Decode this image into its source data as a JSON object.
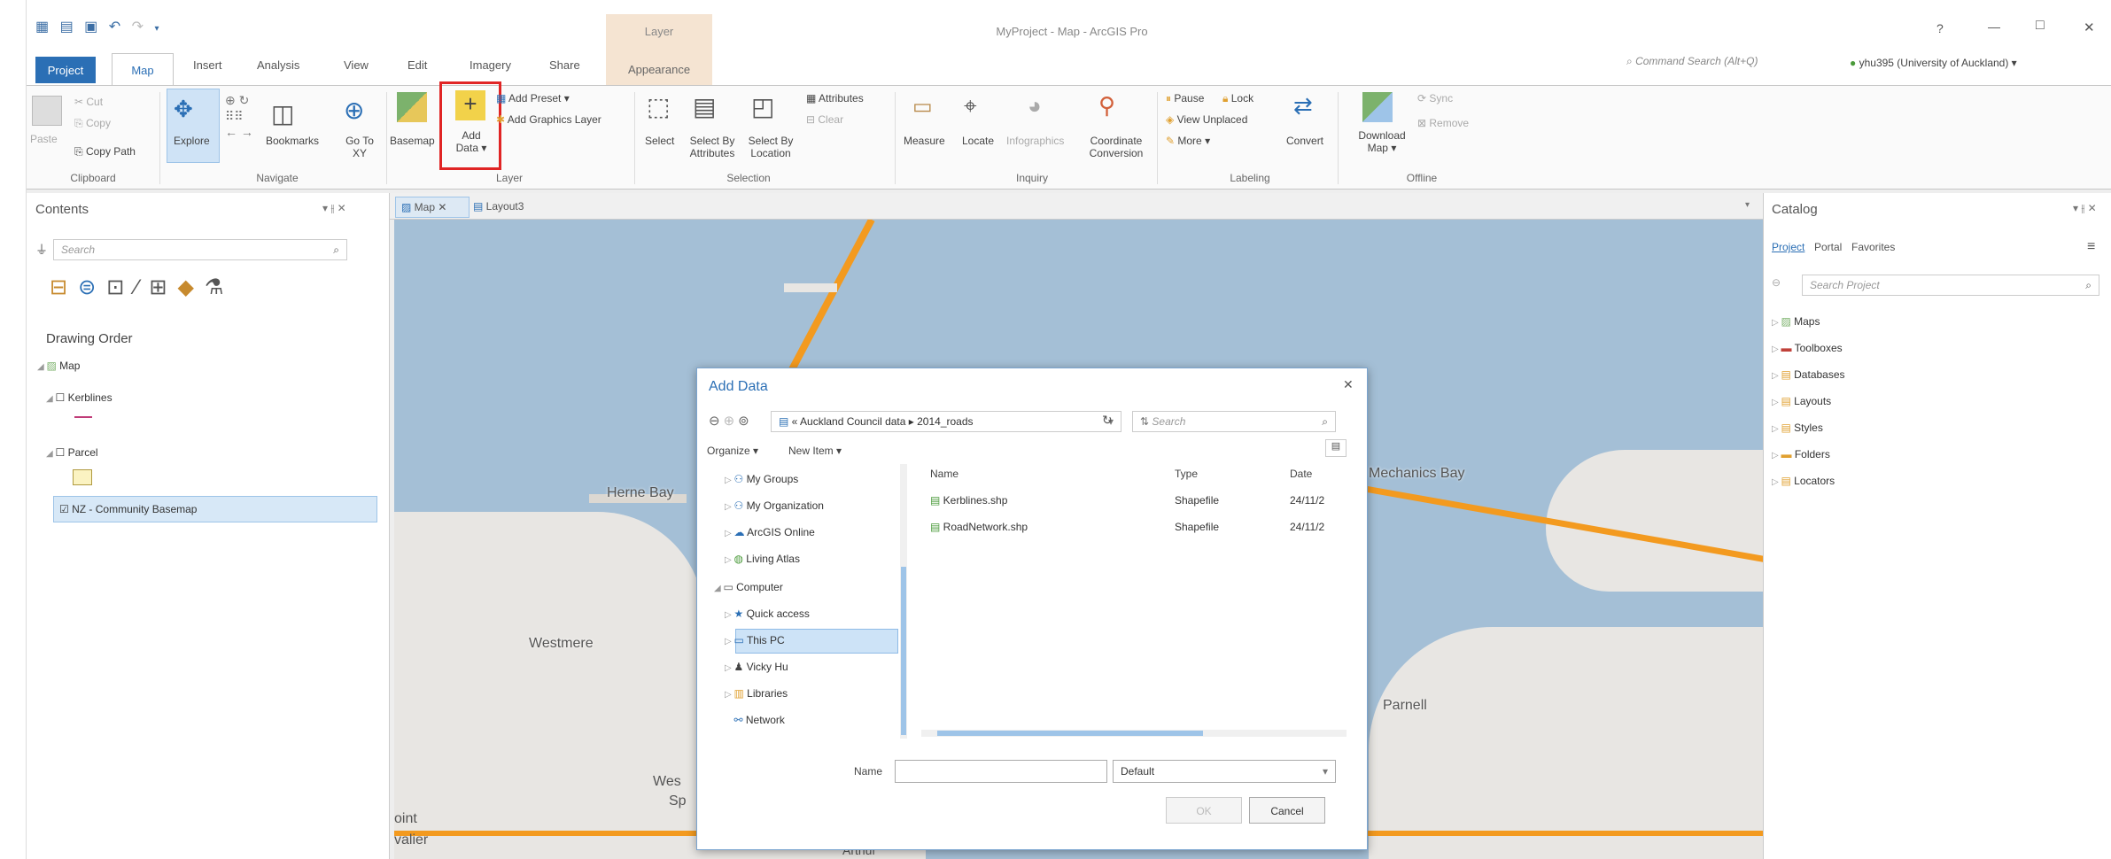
{
  "titlebar": {
    "title": "MyProject - Map - ArcGIS Pro",
    "context_header": "Layer",
    "help": "?",
    "min": "—",
    "max": "□",
    "close": "✕"
  },
  "tabs": [
    "Project",
    "Map",
    "Insert",
    "Analysis",
    "View",
    "Edit",
    "Imagery",
    "Share",
    "Appearance"
  ],
  "search": {
    "placeholder": "Command Search (Alt+Q)"
  },
  "account": {
    "label": "yhu395 (University of Auckland) ▾"
  },
  "ribbon": {
    "clipboard": {
      "paste": "Paste",
      "cut": "Cut",
      "copy": "Copy",
      "copy_path": "Copy Path",
      "label": "Clipboard"
    },
    "navigate": {
      "explore": "Explore",
      "bookmarks": "Bookmarks",
      "goto": "Go To XY",
      "label": "Navigate"
    },
    "layer": {
      "basemap": "Basemap",
      "add_data": "Add Data ▾",
      "add_preset": "Add Preset ▾",
      "add_graphics": "Add Graphics Layer",
      "label": "Layer"
    },
    "selection": {
      "select": "Select",
      "select_by_attr": "Select By Attributes",
      "select_by_loc": "Select By Location",
      "attributes": "Attributes",
      "clear": "Clear",
      "label": "Selection"
    },
    "inquiry": {
      "measure": "Measure",
      "locate": "Locate",
      "infographics": "Infographics",
      "coord": "Coordinate Conversion",
      "label": "Inquiry"
    },
    "labeling": {
      "pause": "Pause",
      "lock": "Lock",
      "view_unplaced": "View Unplaced",
      "more": "More ▾",
      "convert": "Convert",
      "label": "Labeling"
    },
    "offline": {
      "download": "Download Map ▾",
      "sync": "Sync",
      "remove": "Remove",
      "label": "Offline"
    }
  },
  "contents": {
    "title": "Contents",
    "search_placeholder": "Search",
    "drawing_order": "Drawing Order",
    "map": "Map",
    "layers": [
      "Kerblines",
      "Parcel",
      "NZ - Community Basemap"
    ]
  },
  "view_tabs": [
    "Map",
    "Layout3"
  ],
  "map_labels": [
    "Herne Bay",
    "Westmere",
    "Mechanics Bay",
    "Parnell",
    "Wes",
    "Sp",
    "oint",
    "valier",
    "Arthur"
  ],
  "catalog": {
    "title": "Catalog",
    "tabs": [
      "Project",
      "Portal",
      "Favorites"
    ],
    "search_placeholder": "Search Project",
    "items": [
      "Maps",
      "Toolboxes",
      "Databases",
      "Layouts",
      "Styles",
      "Folders",
      "Locators"
    ]
  },
  "dialog": {
    "title": "Add Data",
    "breadcrumb": "« Auckland Council data ▸ 2014_roads",
    "search_placeholder": "Search",
    "organize": "Organize ▾",
    "new_item": "New Item ▾",
    "tree": [
      "My Groups",
      "My Organization",
      "ArcGIS Online",
      "Living Atlas",
      "Computer",
      "Quick access",
      "This PC",
      "Vicky Hu",
      "Libraries",
      "Network"
    ],
    "columns": [
      "Name",
      "Type",
      "Date"
    ],
    "files": [
      {
        "name": "Kerblines.shp",
        "type": "Shapefile",
        "date": "24/11/2"
      },
      {
        "name": "RoadNetwork.shp",
        "type": "Shapefile",
        "date": "24/11/2"
      }
    ],
    "name_label": "Name",
    "filter": "Default",
    "ok": "OK",
    "cancel": "Cancel"
  }
}
